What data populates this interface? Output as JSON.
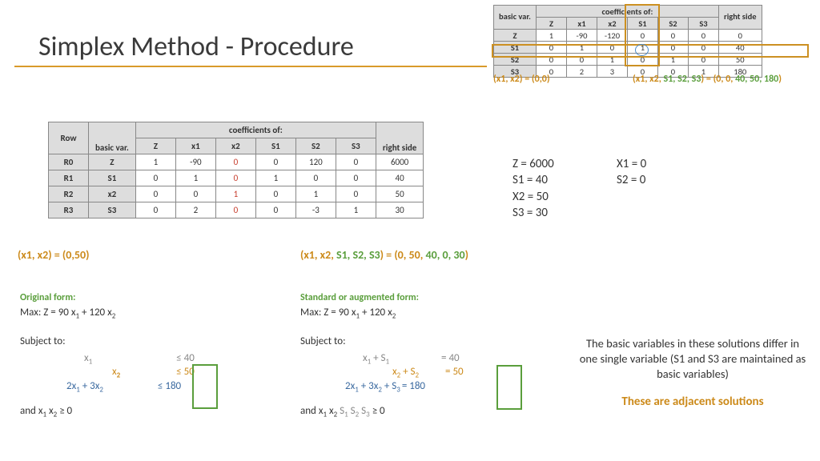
{
  "title": "Simplex Method - Procedure",
  "smallTable": {
    "head": {
      "bv": "basic\nvar.",
      "coef": "coefficients of:",
      "cols": [
        "Z",
        "x1",
        "x2",
        "S1",
        "S2",
        "S3"
      ],
      "rs": "right\nside"
    },
    "rows": [
      {
        "bv": "Z",
        "c": [
          "1",
          "-90",
          "-120",
          "0",
          "0",
          "0"
        ],
        "rs": "0"
      },
      {
        "bv": "S1",
        "c": [
          "0",
          "1",
          "0",
          "1",
          "0",
          "0"
        ],
        "rs": "40"
      },
      {
        "bv": "S2",
        "c": [
          "0",
          "0",
          "1",
          "0",
          "1",
          "0"
        ],
        "rs": "50"
      },
      {
        "bv": "S3",
        "c": [
          "0",
          "2",
          "3",
          "0",
          "0",
          "1"
        ],
        "rs": "180"
      }
    ],
    "belowLeft": "(x1, x2) = (0,0)",
    "belowRight": {
      "pre": "(x1, x2, ",
      "mid": "S1, S2, S3",
      "post": ") = (0, 0, ",
      "vals": "40, 50, 180",
      ")": ")"
    }
  },
  "bigTable": {
    "head": {
      "row": "Row",
      "bv": "basic var.",
      "coef": "coefficients of:",
      "cols": [
        "Z",
        "x1",
        "x2",
        "S1",
        "S2",
        "S3"
      ],
      "rs": "right side"
    },
    "rows": [
      {
        "r": "R0",
        "bv": "Z",
        "c": [
          "1",
          "-90",
          "0",
          "0",
          "120",
          "0"
        ],
        "rs": "6000",
        "x2red": "0"
      },
      {
        "r": "R1",
        "bv": "S1",
        "c": [
          "0",
          "1",
          "0",
          "1",
          "0",
          "0"
        ],
        "rs": "40",
        "x2red": "0"
      },
      {
        "r": "R2",
        "bv": "x2",
        "c": [
          "0",
          "0",
          "1",
          "0",
          "1",
          "0"
        ],
        "rs": "50",
        "x2red": "1"
      },
      {
        "r": "R3",
        "bv": "S3",
        "c": [
          "0",
          "2",
          "0",
          "0",
          "-3",
          "1"
        ],
        "rs": "30",
        "x2red": "0"
      }
    ]
  },
  "solValues": {
    "l1": " Z = 6000",
    "l2": "S1 = 40",
    "l3": "X2 = 50",
    "l4": "S3 = 30",
    "r1": "X1 = 0",
    "r2": "S2 = 0"
  },
  "soln2L": "(x1, x2) = (0,50)",
  "soln2R": {
    "pre": "(x1, x2, ",
    "mid": "S1, S2, S3",
    "post": ") = (0, 50, ",
    "vals": "40, 0, 30",
    "close": ")"
  },
  "orig": {
    "title": "Original form:",
    "max": "Max:    Z = 90 x",
    "x1": "1",
    "plus": " + 120 x",
    "x2": "2",
    "subj": "Subject to:",
    "c1l": "x",
    "c1s": "1",
    "c1r": "≤    40",
    "c2l": "x",
    "c2s": "2",
    "c2r": "≤    50",
    "c3": "2x",
    "c3s1": "1",
    "c3m": " + 3x",
    "c3s2": "2",
    "c3r": "≤  180",
    "and": "and          x",
    "ands1": "1",
    "andm": "   x",
    "ands2": "2",
    "andr": "              ≥ 0"
  },
  "std": {
    "title": "Standard or augmented form:",
    "max": "Max:    Z = 90 x",
    "x1": "1",
    "plus": " + 120 x",
    "x2": "2",
    "subj": "Subject to:",
    "c1": " x",
    "c1s": "1",
    "c1sp": "         + S",
    "c1s1": "1",
    "c1r": "            =    40",
    "c2": "x",
    "c2s": "2",
    "c2sp": "        + S",
    "c2s2": "2",
    "c2r": "      =    50",
    "c3": "2x",
    "c3s1": "1",
    "c3m": " + 3x",
    "c3s2": "2",
    "c3sp": "            + S",
    "c3s3": "3",
    "c3r": "=  180",
    "and": "and          x",
    "as1": "1",
    "am": "   x",
    "as2": "2",
    "asl": "  S",
    "asl1": "1",
    "asl2": " S",
    "asl2n": "2",
    "asl3": " S",
    "asl3n": "3",
    "ar": "   ≥ 0"
  },
  "conclusion": {
    "p1": "The basic variables in these solutions differ in one single variable (S1 and S3 are maintained as basic variables)",
    "p2": "These are adjacent solutions"
  }
}
